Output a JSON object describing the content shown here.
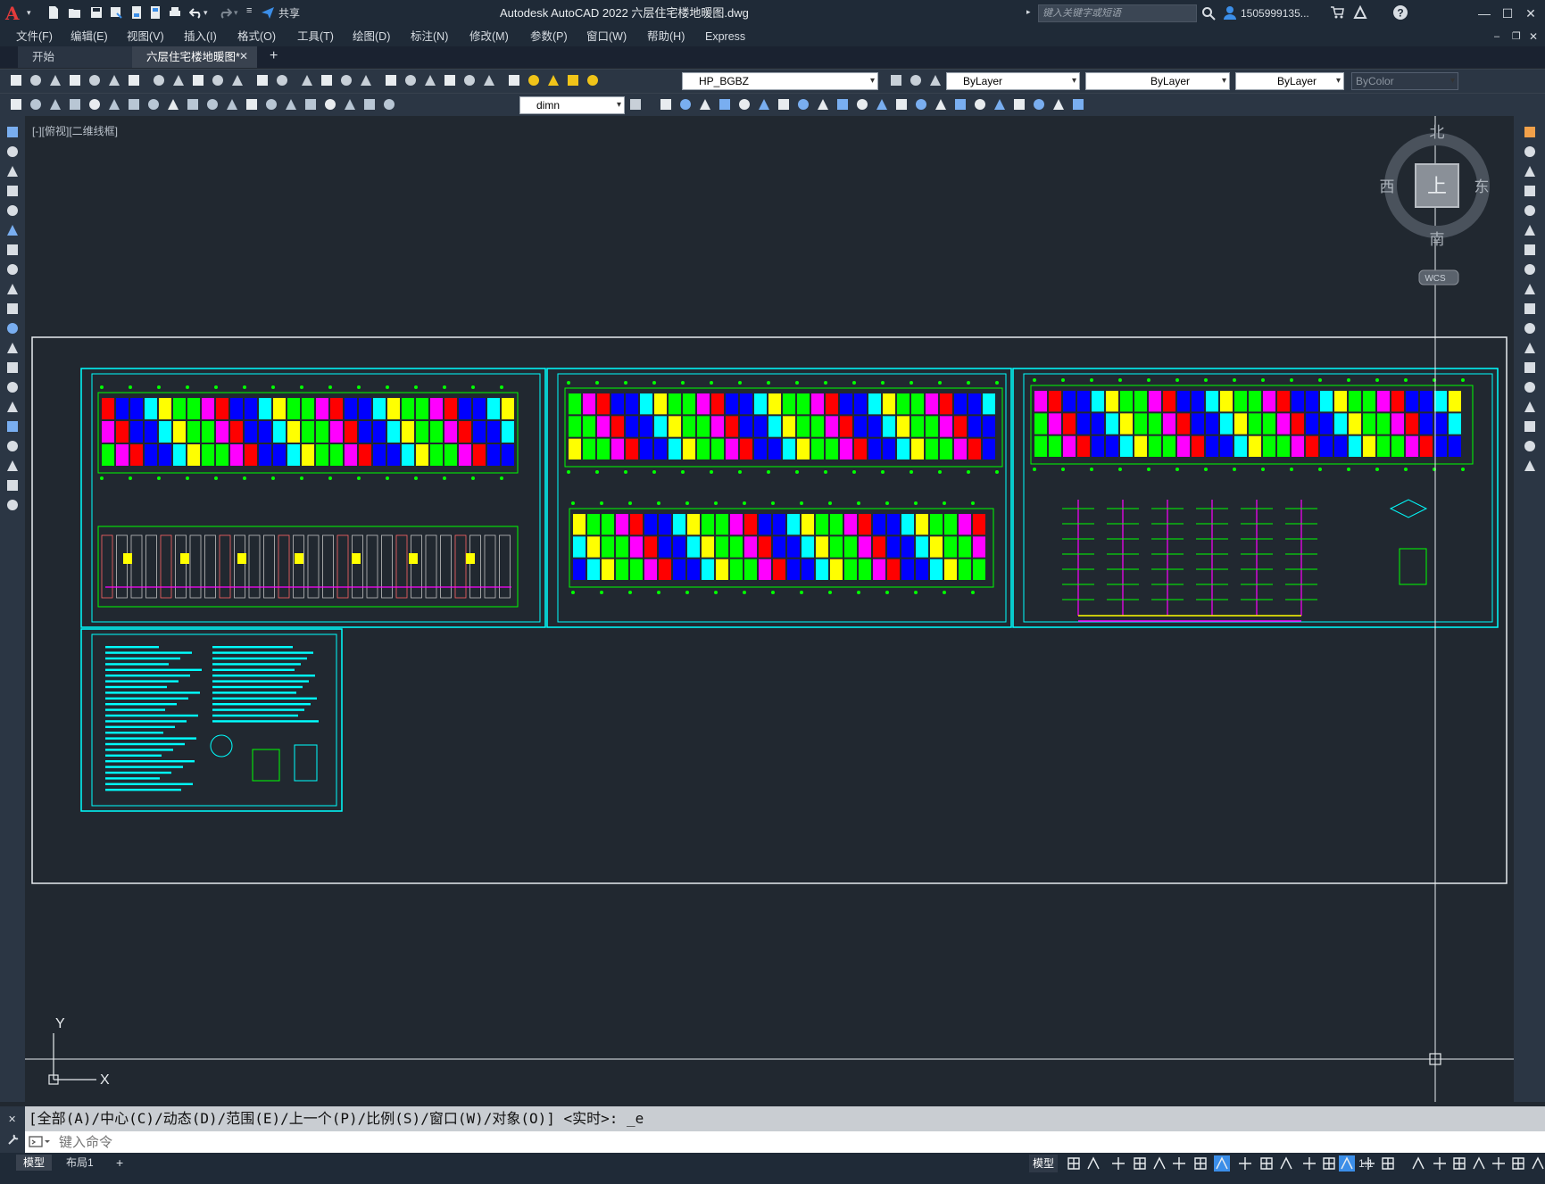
{
  "title_bar": {
    "app_letter": "A",
    "share_label": "共享",
    "title": "Autodesk AutoCAD 2022    六层住宅楼地暖图.dwg",
    "search_placeholder": "键入关键字或短语",
    "user": "1505999135...",
    "minimize": "—",
    "restore": "☐",
    "close": "✕"
  },
  "menu": [
    "文件(F)",
    "编辑(E)",
    "视图(V)",
    "插入(I)",
    "格式(O)",
    "工具(T)",
    "绘图(D)",
    "标注(N)",
    "修改(M)",
    "参数(P)",
    "窗口(W)",
    "帮助(H)",
    "Express"
  ],
  "tabs": {
    "start": "开始",
    "drawing": "六层住宅楼地暖图*",
    "close": "✕",
    "add": "+"
  },
  "toolbar1": {
    "layer": "HP_BGBZ",
    "color": "ByLayer",
    "linetype": "ByLayer",
    "lineweight": "ByLayer",
    "plotstyle": "ByColor"
  },
  "toolbar2": {
    "dimstyle": "dimn"
  },
  "canvas": {
    "view_label": "[-][俯视][二维线框]",
    "viewcube": {
      "north": "北",
      "south": "南",
      "east": "东",
      "west": "西",
      "top": "上",
      "wcs": "WCS"
    },
    "ucs_x": "X",
    "ucs_y": "Y"
  },
  "command": {
    "history": "[全部(A)/中心(C)/动态(D)/范围(E)/上一个(P)/比例(S)/窗口(W)/对象(O)] <实时>: _e",
    "placeholder": "键入命令"
  },
  "status_bar": {
    "layout_model": "模型",
    "layout_1": "布局1",
    "add": "+",
    "model_label": "模型",
    "scale": "1:1"
  },
  "colors": {
    "titlebar": "#1f2a37",
    "canvas": "#212830",
    "sheet_frame": "#00ffff",
    "accent": "#3b8ee8"
  }
}
